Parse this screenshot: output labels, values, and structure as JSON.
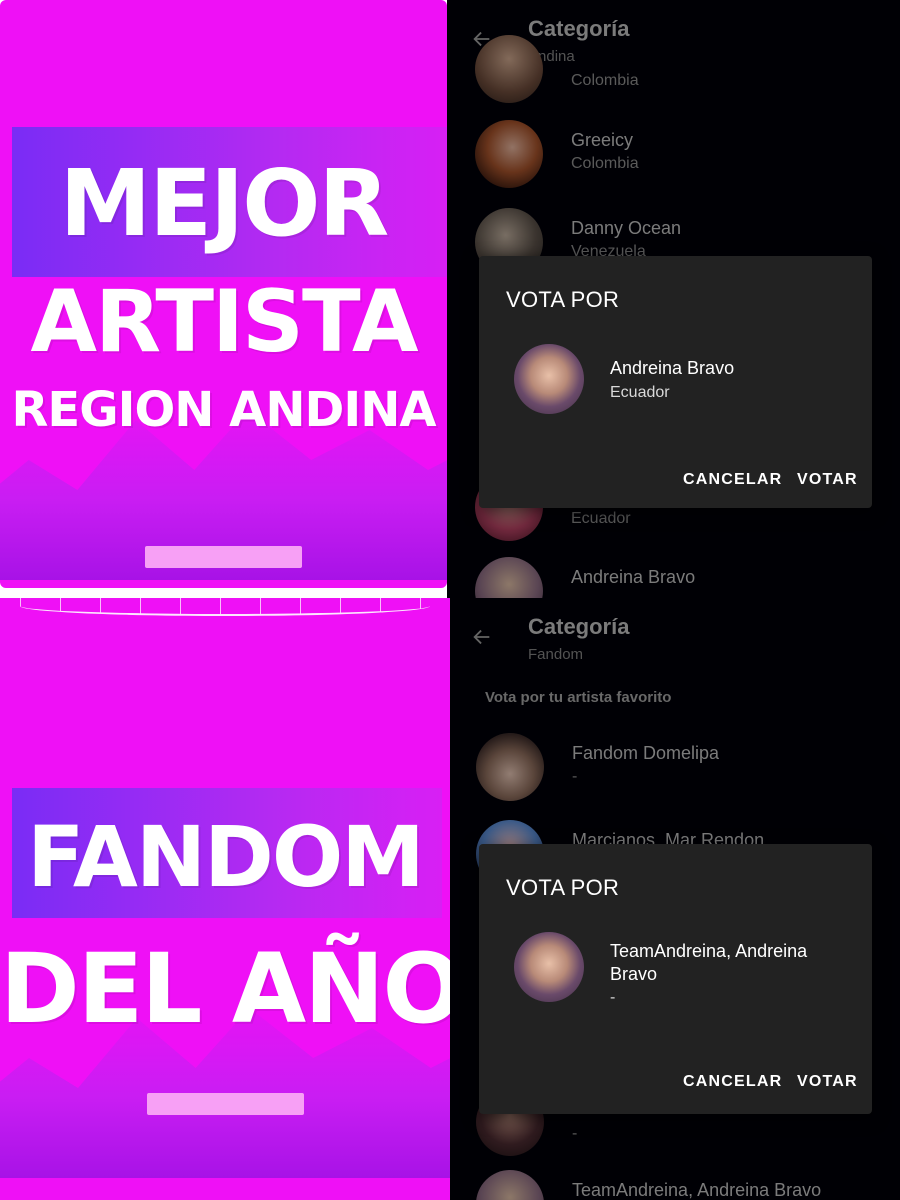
{
  "top_poster": {
    "lines": [
      "MEJOR",
      "ARTISTA",
      "REGION ANDINA"
    ]
  },
  "bottom_poster": {
    "lines": [
      "FANDOM",
      "DEL AÑO"
    ]
  },
  "top_screen": {
    "title": "Categoría",
    "subtitle": "Andina",
    "rows": [
      {
        "name": "",
        "country": "Colombia",
        "avatar": "artist-photo"
      },
      {
        "name": "Greeicy",
        "country": "Colombia",
        "avatar": "artist-photo"
      },
      {
        "name": "Danny Ocean",
        "country": "Venezuela",
        "avatar": "artist-photo"
      },
      {
        "name": "",
        "country": "Ecuador",
        "avatar": "artist-photo"
      },
      {
        "name": "Andreina Bravo",
        "country": "",
        "avatar": "artist-photo"
      }
    ],
    "dialog": {
      "title": "VOTA POR",
      "name": "Andreina Bravo",
      "sub": "Ecuador",
      "cancel": "CANCELAR",
      "vote": "VOTAR"
    }
  },
  "bottom_screen": {
    "title": "Categoría",
    "subtitle": "Fandom",
    "hint": "Vota por tu artista favorito",
    "rows": [
      {
        "name": "Fandom Domelipa",
        "country": "-",
        "avatar": "artist-photo"
      },
      {
        "name": "Marcianos, Mar Rendon",
        "country": "",
        "avatar": "artist-photo"
      },
      {
        "name": "",
        "country": "-",
        "avatar": "artist-photo"
      },
      {
        "name": "TeamAndreina, Andreina Bravo",
        "country": "",
        "avatar": "artist-photo"
      }
    ],
    "dialog": {
      "title": "VOTA POR",
      "name": "TeamAndreina, Andreina Bravo",
      "sub": "-",
      "cancel": "CANCELAR",
      "vote": "VOTAR"
    }
  },
  "icons": {
    "back": "arrow-left-icon"
  },
  "colors": {
    "poster_magenta": "#ef10f6",
    "poster_band": "#7a2cf5",
    "app_background": "#000008",
    "dialog_background": "#222222"
  }
}
